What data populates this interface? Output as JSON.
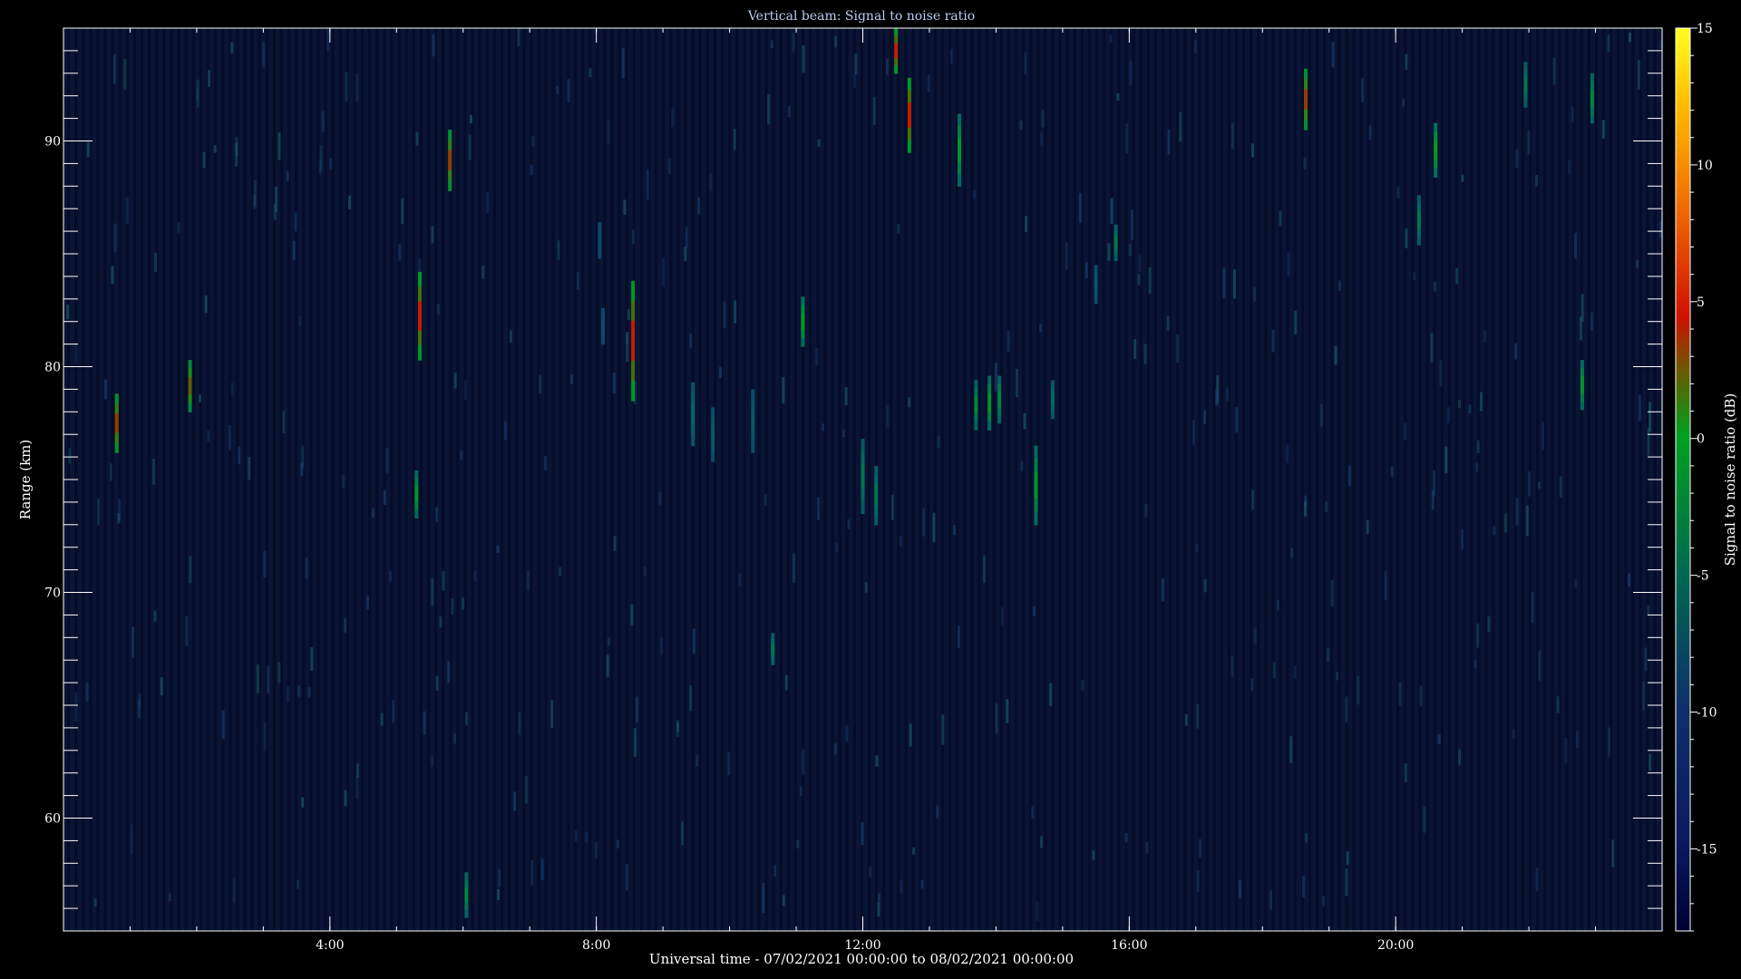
{
  "chart_data": {
    "type": "heatmap",
    "title": "Vertical beam: Signal to noise ratio",
    "xlabel": "Universal time - 07/02/2021 00:00:00 to 08/02/2021 00:00:00",
    "ylabel": "Range (km)",
    "colorbar_label": "Signal to noise ratio (dB)",
    "x_unit": "hours UT",
    "xlim": [
      0,
      24
    ],
    "ylim": [
      55,
      95
    ],
    "x_ticks": [
      {
        "value": 4,
        "label": "4:00"
      },
      {
        "value": 8,
        "label": "8:00"
      },
      {
        "value": 12,
        "label": "12:00"
      },
      {
        "value": 16,
        "label": "16:00"
      },
      {
        "value": 20,
        "label": "20:00"
      }
    ],
    "y_ticks": [
      {
        "value": 60,
        "label": "60"
      },
      {
        "value": 70,
        "label": "70"
      },
      {
        "value": 80,
        "label": "80"
      },
      {
        "value": 90,
        "label": "90"
      }
    ],
    "colorbar": {
      "range": [
        -18,
        15
      ],
      "ticks": [
        {
          "value": 15,
          "label": "15"
        },
        {
          "value": 10,
          "label": "10"
        },
        {
          "value": 5,
          "label": "5"
        },
        {
          "value": 0,
          "label": "0"
        },
        {
          "value": -5,
          "label": "-5"
        },
        {
          "value": -10,
          "label": "-10"
        },
        {
          "value": -15,
          "label": "-15"
        }
      ]
    },
    "background_snr_db": -17,
    "echoes": [
      {
        "time": 0.8,
        "range_min": 76.2,
        "range_max": 78.8,
        "snr_peak": 0
      },
      {
        "time": 1.9,
        "range_min": 78.0,
        "range_max": 80.3,
        "snr_peak": -1
      },
      {
        "time": 5.35,
        "range_min": 80.3,
        "range_max": 84.2,
        "snr_peak": 1
      },
      {
        "time": 5.3,
        "range_min": 73.3,
        "range_max": 75.4,
        "snr_peak": -5
      },
      {
        "time": 5.8,
        "range_min": 87.8,
        "range_max": 90.5,
        "snr_peak": 0
      },
      {
        "time": 6.05,
        "range_min": 55.6,
        "range_max": 57.6,
        "snr_peak": -6
      },
      {
        "time": 8.55,
        "range_min": 78.5,
        "range_max": 83.8,
        "snr_peak": 1
      },
      {
        "time": 11.1,
        "range_min": 80.9,
        "range_max": 83.1,
        "snr_peak": -4
      },
      {
        "time": 12.5,
        "range_min": 93.0,
        "range_max": 95.0,
        "snr_peak": 1
      },
      {
        "time": 12.7,
        "range_min": 89.5,
        "range_max": 92.8,
        "snr_peak": 1
      },
      {
        "time": 13.45,
        "range_min": 88.0,
        "range_max": 91.2,
        "snr_peak": -5
      },
      {
        "time": 14.6,
        "range_min": 73.0,
        "range_max": 76.5,
        "snr_peak": -5
      },
      {
        "time": 15.8,
        "range_min": 84.7,
        "range_max": 86.3,
        "snr_peak": -7
      },
      {
        "time": 18.65,
        "range_min": 90.5,
        "range_max": 93.2,
        "snr_peak": 0
      },
      {
        "time": 20.35,
        "range_min": 85.4,
        "range_max": 87.6,
        "snr_peak": -7
      },
      {
        "time": 20.6,
        "range_min": 88.4,
        "range_max": 90.8,
        "snr_peak": -4
      },
      {
        "time": 21.95,
        "range_min": 91.5,
        "range_max": 93.5,
        "snr_peak": -7
      },
      {
        "time": 22.95,
        "range_min": 90.8,
        "range_max": 93.0,
        "snr_peak": -6
      },
      {
        "time": 22.8,
        "range_min": 78.1,
        "range_max": 80.3,
        "snr_peak": -5
      },
      {
        "time": 10.65,
        "range_min": 66.8,
        "range_max": 68.2,
        "snr_peak": -7
      },
      {
        "time": 9.45,
        "range_min": 76.5,
        "range_max": 79.3,
        "snr_peak": -8
      },
      {
        "time": 9.75,
        "range_min": 75.8,
        "range_max": 78.2,
        "snr_peak": -9
      },
      {
        "time": 10.35,
        "range_min": 76.2,
        "range_max": 79.0,
        "snr_peak": -9
      },
      {
        "time": 12.0,
        "range_min": 73.5,
        "range_max": 76.8,
        "snr_peak": -7
      },
      {
        "time": 12.2,
        "range_min": 73.0,
        "range_max": 75.6,
        "snr_peak": -7
      },
      {
        "time": 13.7,
        "range_min": 77.2,
        "range_max": 79.4,
        "snr_peak": -6
      },
      {
        "time": 13.9,
        "range_min": 77.2,
        "range_max": 79.6,
        "snr_peak": -5
      },
      {
        "time": 14.05,
        "range_min": 77.5,
        "range_max": 79.6,
        "snr_peak": -6
      },
      {
        "time": 14.85,
        "range_min": 77.7,
        "range_max": 79.4,
        "snr_peak": -8
      },
      {
        "time": 15.5,
        "range_min": 82.8,
        "range_max": 84.5,
        "snr_peak": -9
      },
      {
        "time": 8.05,
        "range_min": 84.8,
        "range_max": 86.4,
        "snr_peak": -10
      },
      {
        "time": 8.1,
        "range_min": 81.0,
        "range_max": 82.6,
        "snr_peak": -10
      }
    ]
  }
}
